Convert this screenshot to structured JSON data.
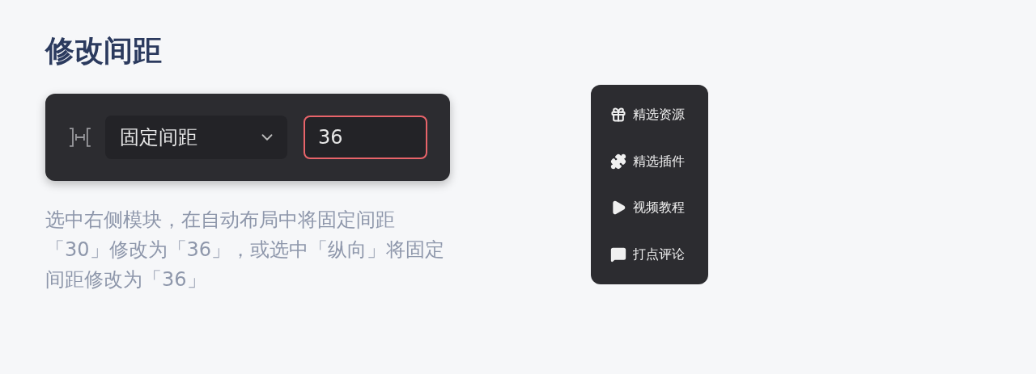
{
  "title": "修改间距",
  "toolbar": {
    "mode": "固定间距",
    "value": "36",
    "focused": true
  },
  "description": "选中右侧模块，在自动布局中将固定间距「30」修改为「36」，或选中「纵向」将固定间距修改为「36」",
  "menu": [
    {
      "kind": "gift",
      "label": "精选资源"
    },
    {
      "kind": "puzzle",
      "label": "精选插件"
    },
    {
      "kind": "play",
      "label": "视频教程"
    },
    {
      "kind": "comment",
      "label": "打点评论"
    }
  ]
}
